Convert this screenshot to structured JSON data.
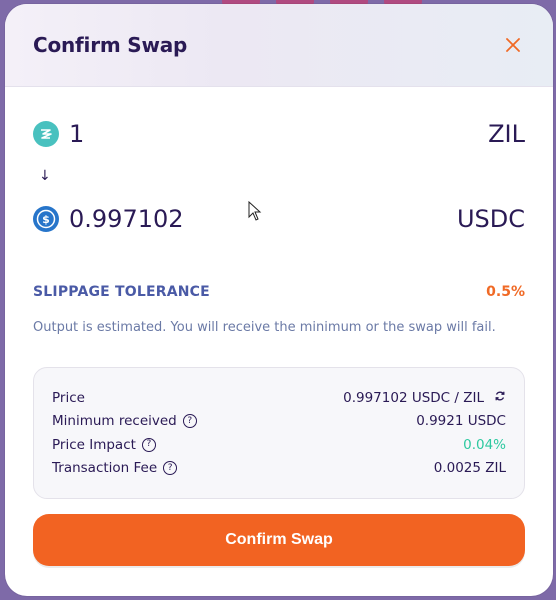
{
  "modal": {
    "title": "Confirm Swap",
    "close_icon": "close-icon"
  },
  "from_token": {
    "amount": "1",
    "symbol": "ZIL",
    "icon": "zil-token-icon",
    "icon_color": "#49c1bf"
  },
  "to_token": {
    "amount": "0.997102",
    "symbol": "USDC",
    "icon": "usdc-token-icon",
    "icon_color": "#2775ca"
  },
  "arrow_glyph": "↓",
  "slippage": {
    "label": "SLIPPAGE TOLERANCE",
    "value": "0.5%"
  },
  "estimate_note": "Output is estimated. You will receive the minimum or the swap will fail.",
  "details": {
    "price_label": "Price",
    "price_value": "0.997102 USDC / ZIL",
    "min_received_label": "Minimum received",
    "min_received_value": "0.9921 USDC",
    "price_impact_label": "Price Impact",
    "price_impact_value": "0.04%",
    "fee_label": "Transaction Fee",
    "fee_value": "0.0025 ZIL"
  },
  "confirm_button": "Confirm Swap",
  "colors": {
    "accent": "#f26322",
    "title": "#2a1a55",
    "positive": "#2ec9a0",
    "label_blue": "#4a5aa6"
  }
}
